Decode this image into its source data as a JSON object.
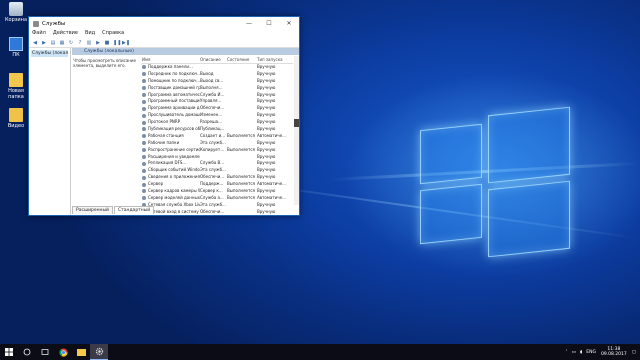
{
  "desktop": {
    "icons": [
      {
        "label": "Корзина",
        "icon": "recycle-bin-icon"
      },
      {
        "label": "ПК",
        "icon": "computer-icon"
      },
      {
        "label": "Новая папка",
        "icon": "folder-icon"
      },
      {
        "label": "Видео",
        "icon": "video-file-icon"
      }
    ]
  },
  "window": {
    "title": "Службы",
    "controls": {
      "minimize": "—",
      "maximize": "☐",
      "close": "✕"
    },
    "menu": [
      "Файл",
      "Действие",
      "Вид",
      "Справка"
    ],
    "tree_item": "Службы (локальн",
    "panel_header": "Службы (локальные)",
    "description": "Чтобы просмотреть описание элемента, выделите его.",
    "columns": [
      "Имя",
      "Описание",
      "Состояние",
      "Тип запуска"
    ],
    "rows": [
      [
        "Поддержка панели...",
        "",
        "",
        "Вручную"
      ],
      [
        "Посредник по подключ...",
        "Выход",
        "",
        "Вручную"
      ],
      [
        "Помощник по подключ...",
        "Выход св...",
        "",
        "Вручную"
      ],
      [
        "Поставщик домашней гру...",
        "Выполня...",
        "",
        "Вручную"
      ],
      [
        "Программа автоматическ...",
        "Служба И...",
        "",
        "Вручную"
      ],
      [
        "Программный поставщик...",
        "Управля...",
        "",
        "Вручную"
      ],
      [
        "Программа архивации дан...",
        "Обеспечи...",
        "",
        "Вручную"
      ],
      [
        "Прослушиватель домашне...",
        "Изменен...",
        "",
        "Вручную"
      ],
      [
        "Протокол PNRP",
        "Разреша...",
        "",
        "Вручную"
      ],
      [
        "Публикация ресурсов обн...",
        "Публикац...",
        "",
        "Вручную"
      ],
      [
        "Рабочая станция",
        "Создает и...",
        "Выполняется",
        "Автоматиче..."
      ],
      [
        "Рабочие папки",
        "Эта служб...",
        "",
        "Вручную"
      ],
      [
        "Распространение сертифи...",
        "Копирует...",
        "Выполняется",
        "Вручную"
      ],
      [
        "Расширения и уведомлен...",
        "",
        "",
        "Вручную"
      ],
      [
        "Репликация DFS...",
        "Служба В...",
        "",
        "Вручную"
      ],
      [
        "Сборщик событий Windows",
        "Эта служб...",
        "",
        "Вручную"
      ],
      [
        "Сведения о приложениях",
        "Обеспечи...",
        "Выполняется",
        "Вручную"
      ],
      [
        "Сервер",
        "Поддерж...",
        "Выполняется",
        "Автоматиче..."
      ],
      [
        "Сервер кадров камеры Wi...",
        "Сервер к...",
        "Выполняется",
        "Вручную"
      ],
      [
        "Сервер моделей данных пл...",
        "Служба а...",
        "Выполняется",
        "Автоматиче..."
      ],
      [
        "Сетевая служба Xbox Live",
        "Эта служб...",
        "",
        "Вручную"
      ],
      [
        "Сетевой вход в систему",
        "Обеспечи...",
        "",
        "Вручную"
      ]
    ],
    "tabs": [
      "Расширенный",
      "Стандартный"
    ]
  },
  "taskbar": {
    "tray_lang": "ENG",
    "time": "11:38",
    "date": "09.08.2017"
  }
}
